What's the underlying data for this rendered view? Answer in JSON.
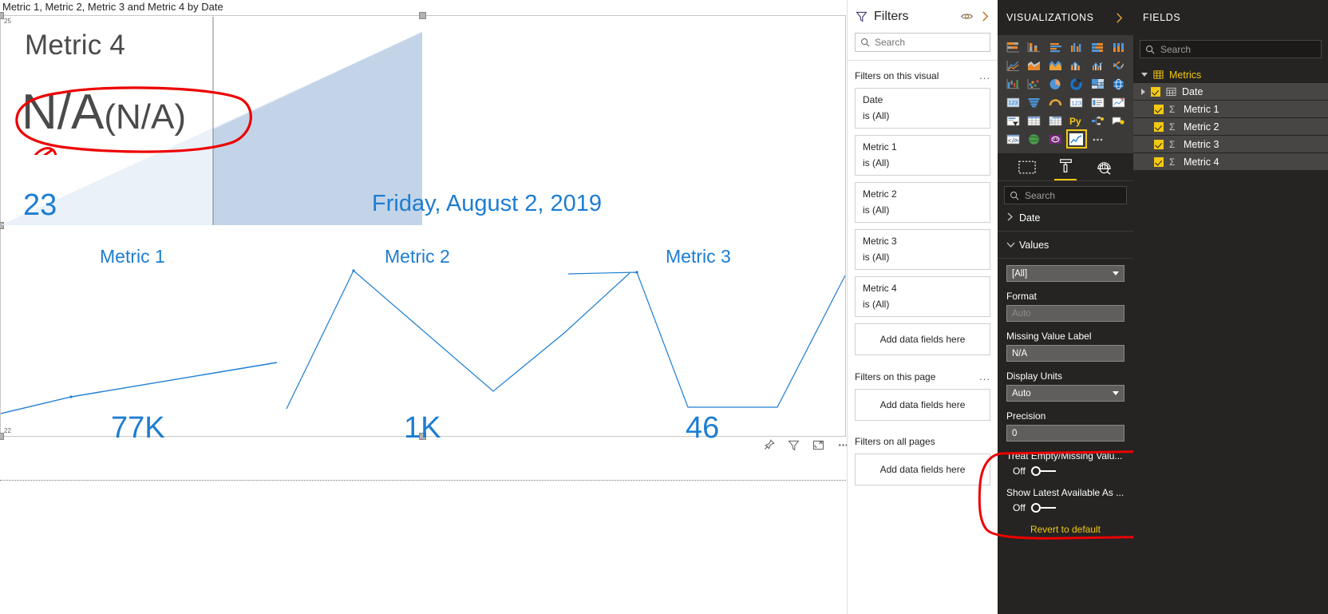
{
  "canvas": {
    "visual_title": "Metric 1, Metric 2, Metric 3 and Metric 4 by Date",
    "axis_max": "25",
    "axis_min": "22",
    "kpi_name": "Metric 4",
    "kpi_value": "N/A",
    "kpi_goal": "(N/A)",
    "date_label": "Friday, August 2, 2019",
    "metric1_label": "Metric 1",
    "metric2_label": "Metric 2",
    "metric3_label": "Metric 3",
    "metric1_value": "77K",
    "metric2_value": "1K",
    "metric3_value": "46",
    "metric4_value": "23",
    "toolbar": {
      "pin_label": "pin-visual",
      "filter_label": "filters",
      "focus_label": "focus-mode",
      "more_label": "more-options"
    }
  },
  "chart_data": {
    "type": "line",
    "title": "Metric 1, Metric 2, Metric 3 and Metric 4 by Date",
    "xlabel": "Date",
    "ylabel": "",
    "ylim": [
      22,
      25
    ],
    "grid": false,
    "legend": "none",
    "selected_date": "Friday, August 2, 2019",
    "kpi": {
      "name": "Metric 4",
      "value": "N/A",
      "goal": "(N/A)",
      "trend_area_present": true
    },
    "sparklines": [
      {
        "name": "Metric 1",
        "display_value": "77K",
        "points": [
          {
            "x": 0,
            "y": 0.12
          },
          {
            "x": 0.25,
            "y": 0.32
          },
          {
            "x": 1,
            "y": 0.8
          }
        ]
      },
      {
        "name": "Metric 2",
        "display_value": "1K",
        "points": [
          {
            "x": 0,
            "y": 0.02
          },
          {
            "x": 0.18,
            "y": 0.97
          },
          {
            "x": 0.55,
            "y": 0.28
          },
          {
            "x": 0.78,
            "y": 0.62
          },
          {
            "x": 1,
            "y": 0.95
          }
        ]
      },
      {
        "name": "Metric 3",
        "display_value": "46",
        "points": [
          {
            "x": 0,
            "y": 0.95
          },
          {
            "x": 0.22,
            "y": 0.97
          },
          {
            "x": 0.52,
            "y": 0.07
          },
          {
            "x": 0.8,
            "y": 0.07
          },
          {
            "x": 1,
            "y": 0.93
          }
        ]
      }
    ],
    "metric4_area": {
      "name": "Metric 4",
      "display_value": "23",
      "series": [
        {
          "x": 0,
          "y": 0.0
        },
        {
          "x": 1,
          "y": 1.0
        }
      ]
    }
  },
  "filters": {
    "title": "Filters",
    "search_placeholder": "Search",
    "visual_group_label": "Filters on this visual",
    "page_group_label": "Filters on this page",
    "all_pages_group_label": "Filters on all pages",
    "add_fields_label": "Add data fields here",
    "more_label": "...",
    "visual_filters": [
      {
        "name": "Date",
        "condition": "is (All)"
      },
      {
        "name": "Metric 1",
        "condition": "is (All)"
      },
      {
        "name": "Metric 2",
        "condition": "is (All)"
      },
      {
        "name": "Metric 3",
        "condition": "is (All)"
      },
      {
        "name": "Metric 4",
        "condition": "is (All)"
      }
    ]
  },
  "visualizations": {
    "title": "VISUALIZATIONS",
    "search_placeholder": "Search",
    "icons": [
      "stacked-bar-chart-icon",
      "stacked-column-chart-icon",
      "clustered-bar-chart-icon",
      "clustered-column-chart-icon",
      "100-stacked-bar-chart-icon",
      "100-stacked-column-chart-icon",
      "line-chart-icon",
      "area-chart-icon",
      "stacked-area-chart-icon",
      "line-stacked-column-chart-icon",
      "line-clustered-column-chart-icon",
      "ribbon-chart-icon",
      "waterfall-chart-icon",
      "scatter-chart-icon",
      "pie-chart-icon",
      "donut-chart-icon",
      "treemap-icon",
      "map-icon",
      "filled-map-icon",
      "funnel-chart-icon",
      "gauge-chart-icon",
      "card-icon",
      "multi-row-card-icon",
      "kpi-icon",
      "slicer-icon",
      "table-icon",
      "matrix-icon",
      "python-visual-icon",
      "decomposition-tree-icon",
      "key-influencers-icon",
      "r-script-visual-icon",
      "arcgis-map-icon",
      "powerapps-visual-icon",
      "custom-kpi-visual-icon",
      "more-visuals-icon"
    ],
    "selected_icon_index": 33,
    "tabs": [
      "fields-tab",
      "format-tab",
      "analytics-tab"
    ],
    "active_tab": "format-tab",
    "wells": [
      {
        "label": "Date",
        "expanded": false
      },
      {
        "label": "Values",
        "expanded": true
      }
    ],
    "values_selector": "[All]",
    "format_label": "Format",
    "format_placeholder": "Auto",
    "format_value": "",
    "missing_value_label_label": "Missing Value Label",
    "missing_value_label_value": "N/A",
    "display_units_label": "Display Units",
    "display_units_value": "Auto",
    "precision_label": "Precision",
    "precision_value": "0",
    "treat_empty_label": "Treat Empty/Missing Valu...",
    "treat_empty_state": "Off",
    "show_latest_label": "Show Latest Available As ...",
    "show_latest_state": "Off",
    "revert_label": "Revert to default"
  },
  "fields": {
    "title": "FIELDS",
    "search_placeholder": "Search",
    "table_name": "Metrics",
    "items": [
      {
        "label": "Date",
        "checked": true,
        "type": "date",
        "expandable": true
      },
      {
        "label": "Metric 1",
        "checked": true,
        "type": "measure",
        "expandable": false
      },
      {
        "label": "Metric 2",
        "checked": true,
        "type": "measure",
        "expandable": false
      },
      {
        "label": "Metric 3",
        "checked": true,
        "type": "measure",
        "expandable": false
      },
      {
        "label": "Metric 4",
        "checked": true,
        "type": "measure",
        "expandable": false
      }
    ]
  },
  "colors": {
    "accent_blue": "#1d7dd1",
    "annotation_red": "#ee0000",
    "brand_yellow": "#f2c811",
    "pane_dark": "#252423"
  }
}
